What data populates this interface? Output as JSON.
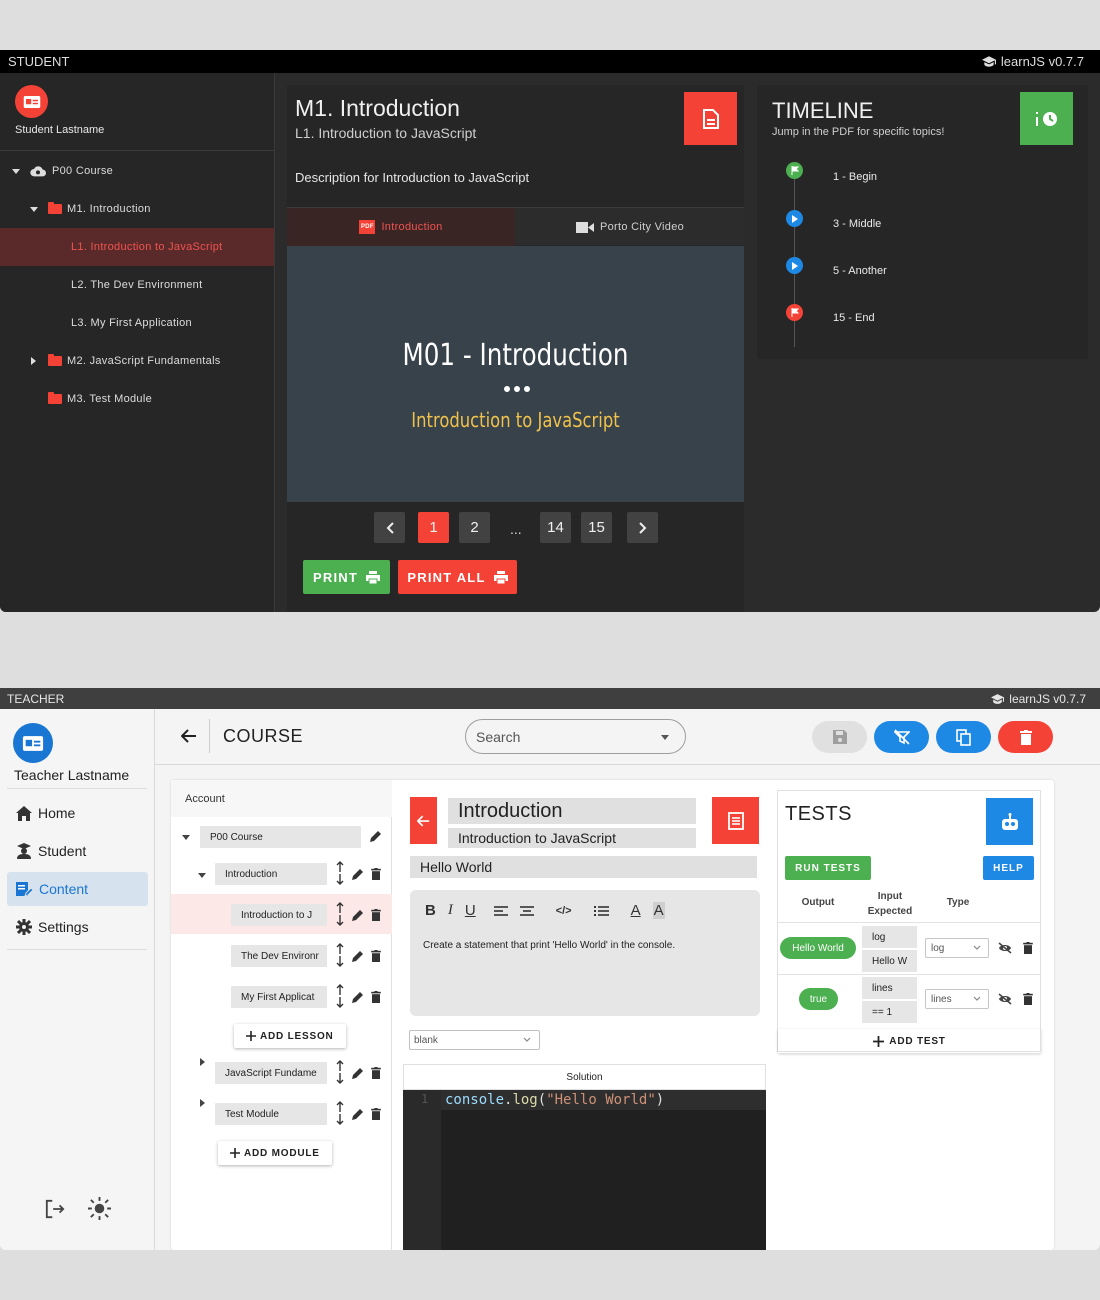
{
  "student": {
    "bar": {
      "role": "STUDENT",
      "brand": "learnJS v0.7.7"
    },
    "user_name": "Student Lastname",
    "tree": [
      {
        "label": "P00 Course"
      },
      {
        "label": "M1.  Introduction"
      },
      {
        "label": "L1.  Introduction to JavaScript"
      },
      {
        "label": "L2.  The Dev Environment"
      },
      {
        "label": "L3.  My First Application"
      },
      {
        "label": "M2.  JavaScript Fundamentals"
      },
      {
        "label": "M3.  Test Module"
      }
    ],
    "lesson": {
      "module_title": "M1. Introduction",
      "lesson_title": "L1. Introduction to JavaScript",
      "description": "Description for Introduction to JavaScript",
      "tabs": [
        {
          "icon_text": "PDF",
          "label": "Introduction"
        },
        {
          "label": "Porto City Video"
        }
      ],
      "slide": {
        "title": "M01 - Introduction",
        "subtitle": "Introduction to JavaScript"
      },
      "pages": [
        "1",
        "2",
        "...",
        "14",
        "15"
      ],
      "current_page": "1",
      "print_label": "PRINT",
      "print_all_label": "PRINT ALL"
    },
    "timeline": {
      "title": "TIMELINE",
      "subtitle": "Jump in the PDF for specific topics!",
      "items": [
        {
          "label": "1 - Begin",
          "color": "#4caf50"
        },
        {
          "label": "3 - Middle",
          "color": "#1e88e5"
        },
        {
          "label": "5 - Another",
          "color": "#1e88e5"
        },
        {
          "label": "15 - End",
          "color": "#f44336"
        }
      ]
    },
    "colors": {
      "accent": "#f44336",
      "success": "#4caf50",
      "info": "#1e88e5"
    }
  },
  "teacher": {
    "bar": {
      "role": "TEACHER",
      "brand": "learnJS v0.7.7"
    },
    "user_name": "Teacher Lastname",
    "nav": [
      {
        "label": "Home"
      },
      {
        "label": "Student"
      },
      {
        "label": "Content"
      },
      {
        "label": "Settings"
      }
    ],
    "header": {
      "title": "COURSE",
      "search_placeholder": "Search"
    },
    "tree": {
      "account_label": "Account",
      "course": "P00 Course",
      "module1": "Introduction",
      "lessons": [
        "Introduction to J",
        "The Dev Environr",
        "My First Applicat"
      ],
      "add_lesson": "ADD LESSON",
      "module2": "JavaScript Fundame",
      "module3": "Test Module",
      "add_module": "ADD MODULE"
    },
    "lesson_editor": {
      "title": "Introduction",
      "subtitle": "Introduction to JavaScript",
      "section_title": "Hello World",
      "body": "Create a statement that print 'Hello World' in the console.",
      "type_select": "blank",
      "solution_label": "Solution",
      "line_number": "1",
      "code": {
        "obj": "console",
        "dot": ".",
        "fn": "log",
        "open": "(",
        "str": "\"Hello World\"",
        "close": ")"
      }
    },
    "tests": {
      "title": "TESTS",
      "run_label": "RUN TESTS",
      "help_label": "HELP",
      "columns": {
        "output": "Output",
        "input_expected": "Input\nExpected",
        "type": "Type"
      },
      "rows": [
        {
          "output": "Hello World",
          "input": "log",
          "expected": "Hello W",
          "type": "log"
        },
        {
          "output": "true",
          "input": "lines",
          "expected": "== 1",
          "type": "lines"
        }
      ],
      "add_label": "ADD TEST"
    },
    "colors": {
      "primary": "#1e88e5",
      "danger": "#f44336",
      "success": "#4caf50",
      "active_nav_bg": "#d6e2ee"
    }
  }
}
